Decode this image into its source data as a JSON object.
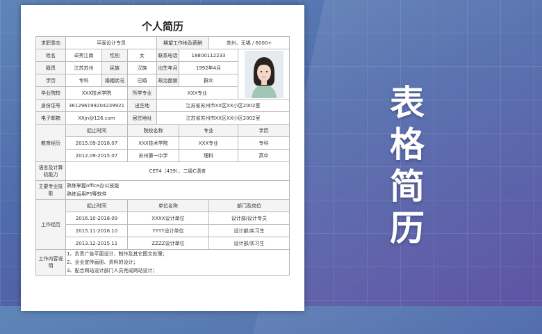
{
  "side_title": [
    "表",
    "格",
    "简",
    "历"
  ],
  "resume": {
    "title": "个人简历",
    "row_intent": {
      "label": "求职意向",
      "value": "平面设计专员",
      "label2": "期望工作地及薪酬",
      "value2": "苏州、无锡 / 6000+"
    },
    "personal": {
      "name_label": "姓名",
      "name": "卓秀江南",
      "gender_label": "性别",
      "gender": "女",
      "phone_label": "联系电话",
      "phone": "18800112233",
      "origin_label": "籍贯",
      "origin": "江苏苏州",
      "ethnic_label": "民族",
      "ethnic": "汉族",
      "birth_label": "出生年月",
      "birth": "1992年4月",
      "degree_label": "学历",
      "degree": "专科",
      "marital_label": "婚姻状况",
      "marital": "已婚",
      "political_label": "政治面貌",
      "political": "群众",
      "school_label": "毕业院校",
      "school": "XXX技术学院",
      "major_label": "所学专业",
      "major": "XXX专业",
      "id_label": "身份证号",
      "id": "361296199204239921",
      "birthplace_label": "出生地",
      "birthplace": "江苏省苏州市XX区XX小区2002室",
      "email_label": "电子邮箱",
      "email": "XXjn@126.com",
      "address_label": "居住地址",
      "address": "江苏省苏州市XX区XX小区2002室"
    },
    "education": {
      "label": "教育经历",
      "headers": [
        "起止时间",
        "院校名称",
        "专业",
        "学历"
      ],
      "rows": [
        [
          "2015.09-2018.07",
          "XXX技术学院",
          "XXX专业",
          "专科"
        ],
        [
          "2012.09-2015.07",
          "苏州第一中学",
          "理科",
          "高中"
        ]
      ]
    },
    "language": {
      "label": "语言及计算机能力",
      "value": "CET4（439）、二级C语言"
    },
    "skills": {
      "label": "主要专业技能",
      "items": [
        "熟练掌握office办公技能",
        "熟练运用PS等软件"
      ]
    },
    "work": {
      "label": "工作经历",
      "headers": [
        "起止时间",
        "单位名称",
        "部门及岗位"
      ],
      "rows": [
        [
          "2016.10-2018.09",
          "XXXX设计单位",
          "设计部/设计专员"
        ],
        [
          "2015.11-2016.10",
          "YYYY设计单位",
          "设计部/实习生"
        ],
        [
          "2013.12-2015.11",
          "ZZZZ设计单位",
          "设计部/实习生"
        ]
      ]
    },
    "duties": {
      "label": "工作内容说明",
      "items": [
        "1、负责广告平面设计、制作及其它图文处理；",
        "2、企业宣传画册、资料的设计；",
        "3、配合网站设计部门人员完成网站设计；"
      ]
    }
  },
  "colors": {
    "accent": "#5a4fa2",
    "paper": "#ffffff"
  }
}
